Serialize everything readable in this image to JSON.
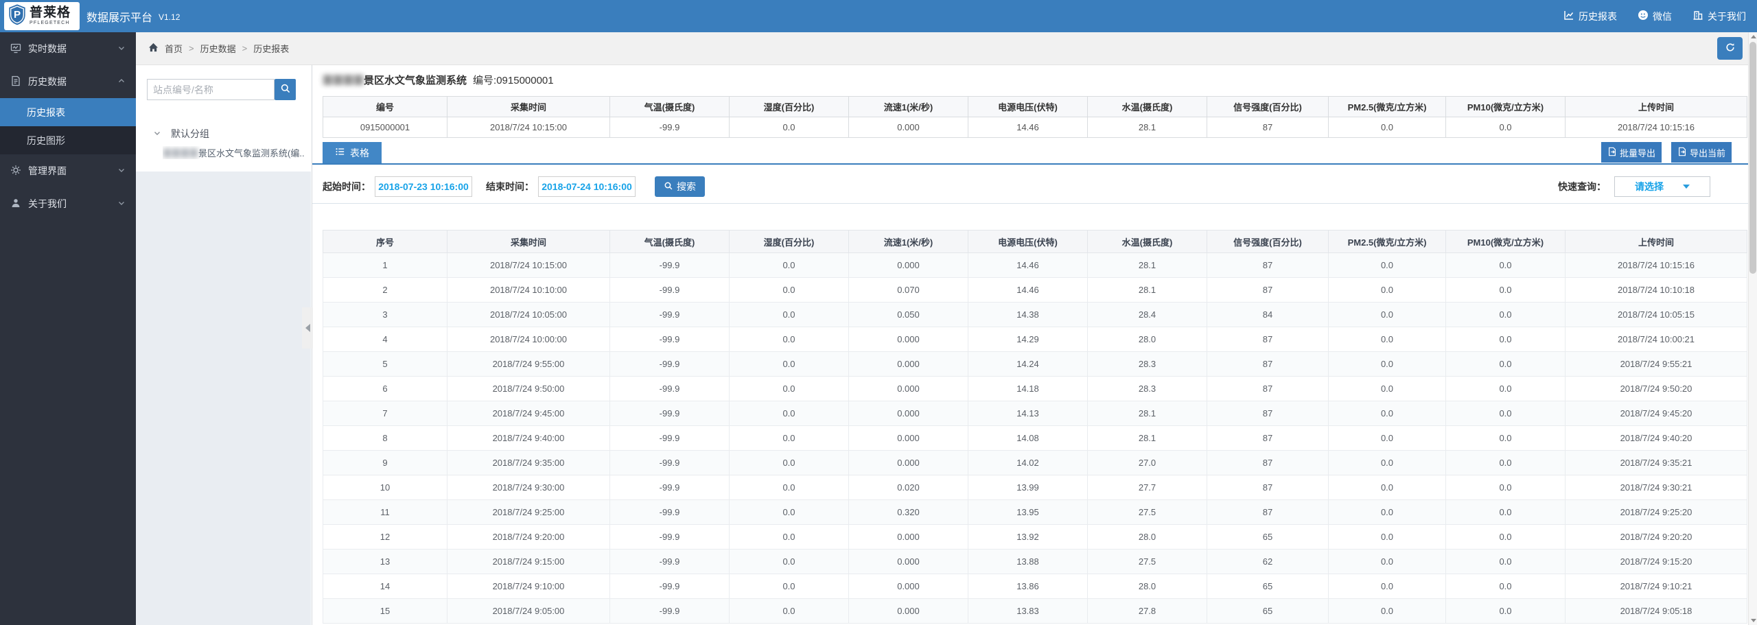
{
  "topbar": {
    "brand_cn": "普莱格",
    "brand_en": "PFLEGETECH",
    "app_title": "数据展示平台",
    "version": "V1.12",
    "link_report": "历史报表",
    "link_wechat": "微信",
    "link_about": "关于我们"
  },
  "sidebar": {
    "realtime": "实时数据",
    "history": "历史数据",
    "history_report": "历史报表",
    "history_graph": "历史图形",
    "admin": "管理界面",
    "about": "关于我们"
  },
  "breadcrumb": {
    "home": "首页",
    "level1": "历史数据",
    "level2": "历史报表",
    "separator": ">"
  },
  "station_panel": {
    "search_placeholder": "站点编号/名称",
    "group_label": "默认分组",
    "station_redacted": "〓〓〓〓",
    "station_name": "景区水文气象监测系统(编..."
  },
  "content": {
    "title_redacted": "〓〓〓〓",
    "title_name": "景区水文气象监测系统",
    "title_no": "编号:0915000001",
    "tab_label": "表格",
    "export_batch": "批量导出",
    "export_current": "导出当前",
    "filter": {
      "start_label": "起始时间：",
      "start_value": "2018-07-23 10:16:00",
      "end_label": "结束时间：",
      "end_value": "2018-07-24 10:16:00",
      "search_label": "搜索",
      "quick_label": "快速查询：",
      "quick_value": "请选择"
    },
    "summary": {
      "headers": [
        "编号",
        "采集时间",
        "气温(摄氏度)",
        "湿度(百分比)",
        "流速1(米/秒)",
        "电源电压(伏特)",
        "水温(摄氏度)",
        "信号强度(百分比)",
        "PM2.5(微克/立方米)",
        "PM10(微克/立方米)",
        "上传时间"
      ],
      "rows": [
        [
          "0915000001",
          "2018/7/24 10:15:00",
          "-99.9",
          "0.0",
          "0.000",
          "14.46",
          "28.1",
          "87",
          "0.0",
          "0.0",
          "2018/7/24 10:15:16"
        ]
      ]
    },
    "table": {
      "headers": [
        "序号",
        "采集时间",
        "气温(摄氏度)",
        "湿度(百分比)",
        "流速1(米/秒)",
        "电源电压(伏特)",
        "水温(摄氏度)",
        "信号强度(百分比)",
        "PM2.5(微克/立方米)",
        "PM10(微克/立方米)",
        "上传时间"
      ],
      "rows": [
        [
          "1",
          "2018/7/24 10:15:00",
          "-99.9",
          "0.0",
          "0.000",
          "14.46",
          "28.1",
          "87",
          "0.0",
          "0.0",
          "2018/7/24 10:15:16"
        ],
        [
          "2",
          "2018/7/24 10:10:00",
          "-99.9",
          "0.0",
          "0.070",
          "14.46",
          "28.1",
          "87",
          "0.0",
          "0.0",
          "2018/7/24 10:10:18"
        ],
        [
          "3",
          "2018/7/24 10:05:00",
          "-99.9",
          "0.0",
          "0.050",
          "14.38",
          "28.4",
          "84",
          "0.0",
          "0.0",
          "2018/7/24 10:05:15"
        ],
        [
          "4",
          "2018/7/24 10:00:00",
          "-99.9",
          "0.0",
          "0.000",
          "14.29",
          "28.0",
          "87",
          "0.0",
          "0.0",
          "2018/7/24 10:00:21"
        ],
        [
          "5",
          "2018/7/24 9:55:00",
          "-99.9",
          "0.0",
          "0.000",
          "14.24",
          "28.3",
          "87",
          "0.0",
          "0.0",
          "2018/7/24 9:55:21"
        ],
        [
          "6",
          "2018/7/24 9:50:00",
          "-99.9",
          "0.0",
          "0.000",
          "14.18",
          "28.3",
          "87",
          "0.0",
          "0.0",
          "2018/7/24 9:50:20"
        ],
        [
          "7",
          "2018/7/24 9:45:00",
          "-99.9",
          "0.0",
          "0.000",
          "14.13",
          "28.1",
          "87",
          "0.0",
          "0.0",
          "2018/7/24 9:45:20"
        ],
        [
          "8",
          "2018/7/24 9:40:00",
          "-99.9",
          "0.0",
          "0.000",
          "14.08",
          "28.1",
          "87",
          "0.0",
          "0.0",
          "2018/7/24 9:40:20"
        ],
        [
          "9",
          "2018/7/24 9:35:00",
          "-99.9",
          "0.0",
          "0.000",
          "14.02",
          "27.0",
          "87",
          "0.0",
          "0.0",
          "2018/7/24 9:35:21"
        ],
        [
          "10",
          "2018/7/24 9:30:00",
          "-99.9",
          "0.0",
          "0.020",
          "13.99",
          "27.7",
          "87",
          "0.0",
          "0.0",
          "2018/7/24 9:30:21"
        ],
        [
          "11",
          "2018/7/24 9:25:00",
          "-99.9",
          "0.0",
          "0.320",
          "13.95",
          "27.5",
          "87",
          "0.0",
          "0.0",
          "2018/7/24 9:25:20"
        ],
        [
          "12",
          "2018/7/24 9:20:00",
          "-99.9",
          "0.0",
          "0.000",
          "13.92",
          "28.0",
          "65",
          "0.0",
          "0.0",
          "2018/7/24 9:20:20"
        ],
        [
          "13",
          "2018/7/24 9:15:00",
          "-99.9",
          "0.0",
          "0.000",
          "13.88",
          "27.5",
          "62",
          "0.0",
          "0.0",
          "2018/7/24 9:15:20"
        ],
        [
          "14",
          "2018/7/24 9:10:00",
          "-99.9",
          "0.0",
          "0.000",
          "13.86",
          "28.0",
          "65",
          "0.0",
          "0.0",
          "2018/7/24 9:10:21"
        ],
        [
          "15",
          "2018/7/24 9:05:00",
          "-99.9",
          "0.0",
          "0.000",
          "13.83",
          "27.8",
          "65",
          "0.0",
          "0.0",
          "2018/7/24 9:05:18"
        ]
      ]
    }
  },
  "colors": {
    "accent": "#3a7ebd",
    "date_text": "#18a3e8",
    "sidebar_bg": "#2d323d"
  }
}
